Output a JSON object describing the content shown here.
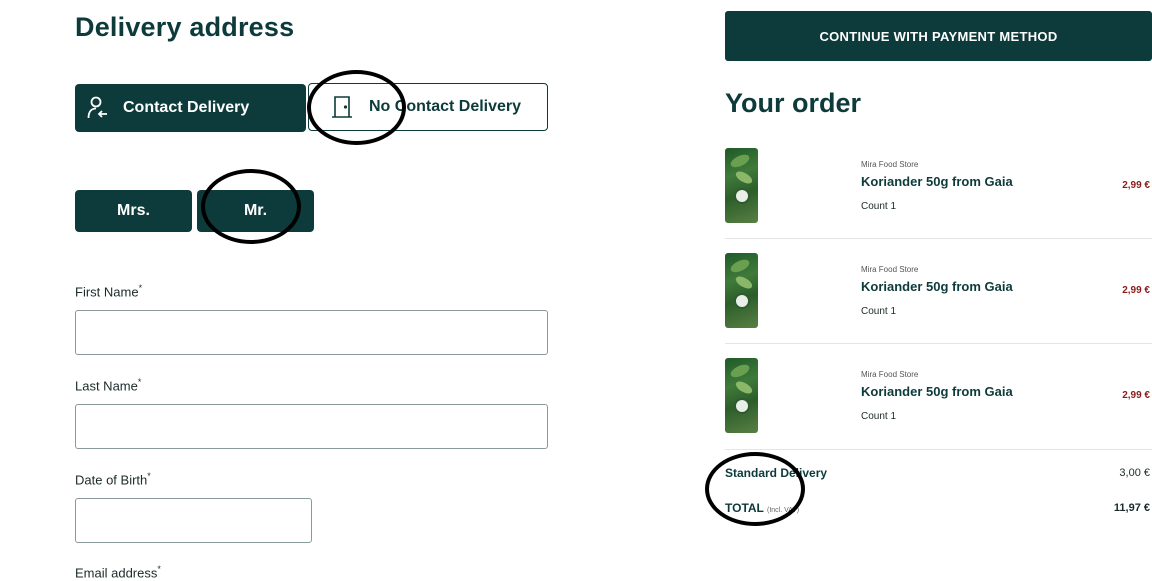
{
  "delivery": {
    "title": "Delivery address",
    "contact_label": "Contact Delivery",
    "no_contact_label": "No Contact Delivery"
  },
  "salutation": {
    "mrs": "Mrs.",
    "mr": "Mr."
  },
  "fields": {
    "first_name_label": "First Name",
    "last_name_label": "Last Name",
    "dob_label": "Date of Birth",
    "email_label": "Email address",
    "required_mark": "*"
  },
  "cta": {
    "label": "CONTINUE WITH PAYMENT METHOD"
  },
  "order": {
    "title": "Your order",
    "items": [
      {
        "store": "Mira Food Store",
        "name": "Koriander 50g from Gaia",
        "count": "Count 1",
        "price": "2,99 €"
      },
      {
        "store": "Mira Food Store",
        "name": "Koriander 50g from Gaia",
        "count": "Count 1",
        "price": "2,99 €"
      },
      {
        "store": "Mira Food Store",
        "name": "Koriander 50g from Gaia",
        "count": "Count 1",
        "price": "2,99 €"
      }
    ],
    "shipping_label": "Standard Delivery",
    "shipping_value": "3,00 €",
    "total_label": "TOTAL",
    "total_note": "(Incl. VAT)",
    "total_value": "11,97 €"
  },
  "icons": {
    "contact": "person-handoff-icon",
    "no_contact": "door-icon"
  },
  "colors": {
    "primary": "#0d3a3a",
    "price": "#8b1a1a",
    "annotation": "#000000"
  }
}
